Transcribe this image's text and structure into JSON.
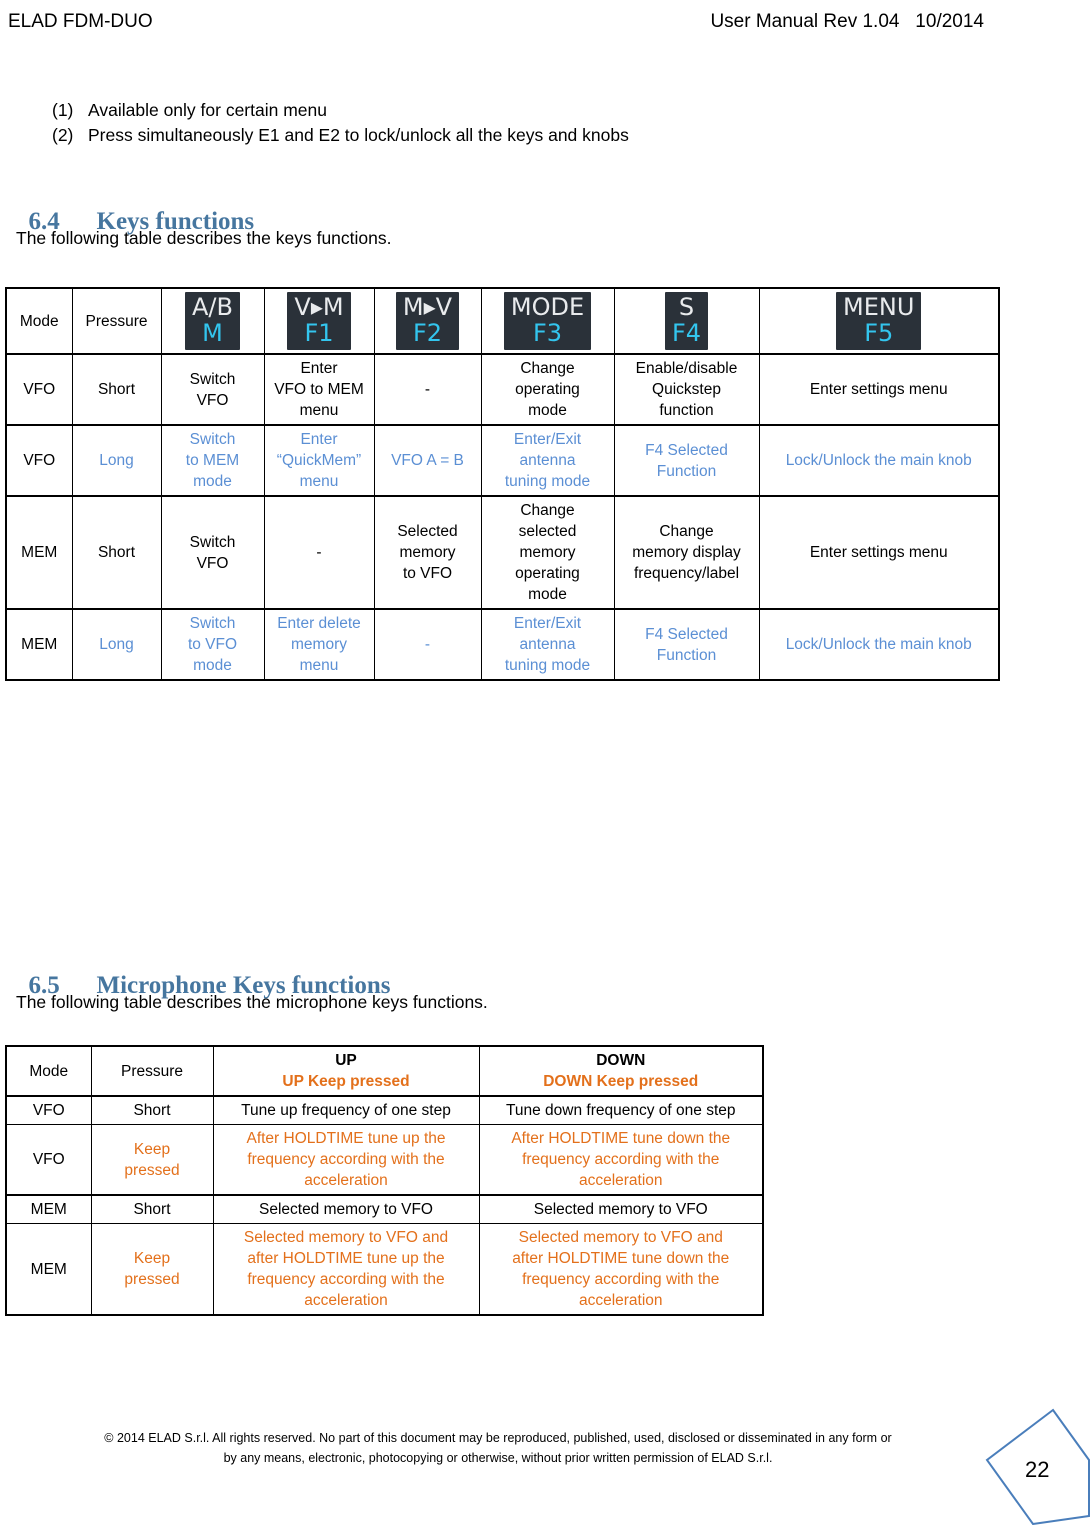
{
  "header": {
    "left": "ELAD FDM-DUO",
    "right": "User Manual Rev 1.04   10/2014"
  },
  "notes": [
    {
      "num": "(1)",
      "text": "Available only for certain menu"
    },
    {
      "num": "(2)",
      "text": "Press simultaneously E1 and E2 to lock/unlock all the keys and knobs"
    }
  ],
  "section_keys": {
    "number": "6.4",
    "title": "Keys functions",
    "intro": "The following table describes the keys functions."
  },
  "keys_table": {
    "header": {
      "mode": "Mode",
      "pressure": "Pressure",
      "keys": [
        {
          "name": "key-ab-m",
          "top": "A/B",
          "bottom": "M"
        },
        {
          "name": "key-v-to-m-f1",
          "top": "V▸M",
          "bottom": "F1"
        },
        {
          "name": "key-m-to-v-f2",
          "top": "M▸V",
          "bottom": "F2"
        },
        {
          "name": "key-mode-f3",
          "top": "MODE",
          "bottom": "F3"
        },
        {
          "name": "key-s-f4",
          "top": "S",
          "bottom": "F4"
        },
        {
          "name": "key-menu-f5",
          "top": "MENU",
          "bottom": "F5"
        }
      ]
    },
    "rows": [
      {
        "style": "black",
        "mode": "VFO",
        "pressure": "Short",
        "cells": [
          "Switch\nVFO",
          "Enter\nVFO to MEM\nmenu",
          "-",
          "Change\noperating\nmode",
          "Enable/disable\nQuickstep\nfunction",
          "Enter settings menu"
        ]
      },
      {
        "style": "blue",
        "mode": "VFO",
        "pressure": "Long",
        "cells": [
          "Switch\nto MEM\nmode",
          "Enter\n“QuickMem”\nmenu",
          "VFO A = B",
          "Enter/Exit\nantenna\ntuning mode",
          "F4 Selected\nFunction",
          "Lock/Unlock the main knob"
        ]
      },
      {
        "style": "black",
        "mode": "MEM",
        "pressure": "Short",
        "cells": [
          "Switch\nVFO",
          "-",
          "Selected\nmemory\nto VFO",
          "Change\nselected\nmemory\noperating\nmode",
          "Change\nmemory display\nfrequency/label",
          "Enter settings menu"
        ]
      },
      {
        "style": "blue",
        "mode": "MEM",
        "pressure": "Long",
        "cells": [
          "Switch\nto VFO\nmode",
          "Enter delete\nmemory\nmenu",
          "-",
          "Enter/Exit\nantenna\ntuning mode",
          "F4 Selected\nFunction",
          "Lock/Unlock the main knob"
        ]
      }
    ]
  },
  "section_mic": {
    "number": "6.5",
    "title": "Microphone Keys functions",
    "intro": "The following table describes the microphone keys functions."
  },
  "mic_table": {
    "header": {
      "mode": "Mode",
      "pressure": "Pressure",
      "up_top": "UP",
      "up_bottom": "UP Keep pressed",
      "down_top": "DOWN",
      "down_bottom": "DOWN Keep pressed"
    },
    "rows": [
      {
        "style": "black",
        "mode": "VFO",
        "pressure": "Short",
        "up": "Tune up frequency of one step",
        "down": "Tune down frequency of one step"
      },
      {
        "style": "orange",
        "mode": "VFO",
        "pressure": "Keep\npressed",
        "up": "After HOLDTIME tune up the\nfrequency according with the\nacceleration",
        "down": "After HOLDTIME tune down the\nfrequency according with the\nacceleration"
      },
      {
        "style": "black",
        "mode": "MEM",
        "pressure": "Short",
        "up": "Selected memory to VFO",
        "down": "Selected memory to VFO"
      },
      {
        "style": "orange",
        "mode": "MEM",
        "pressure": "Keep\npressed",
        "up": "Selected memory to VFO and\nafter HOLDTIME tune up the\nfrequency according with the\nacceleration",
        "down": "Selected memory to VFO and\nafter HOLDTIME tune down the\nfrequency according with the\nacceleration"
      }
    ]
  },
  "footer": {
    "line1": "© 2014 ELAD S.r.l. All rights reserved. No part of this document may be reproduced, published, used, disclosed or disseminated in any form or",
    "line2": "by any means, electronic, photocopying or otherwise, without prior written permission of ELAD S.r.l.",
    "page_number": "22"
  },
  "colors": {
    "heading_blue": "#46769f",
    "text_blue": "#5b8fd4",
    "text_orange": "#e3701b",
    "key_bg": "#2a3139",
    "key_label_top": "#e9ebed",
    "key_label_bottom": "#33c5ee"
  }
}
